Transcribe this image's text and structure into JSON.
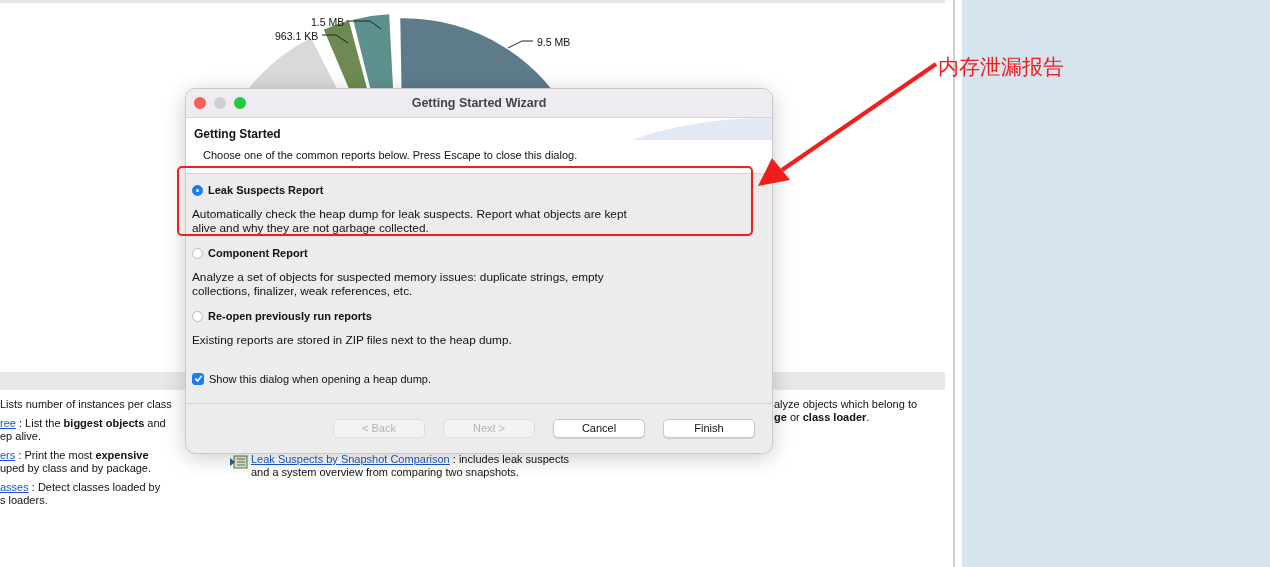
{
  "chart": {
    "labels": [
      {
        "text": "1.5 MB"
      },
      {
        "text": "963.1 KB"
      },
      {
        "text": "9.5 MB"
      }
    ]
  },
  "sections": {
    "left": [
      {
        "lines": [
          "Lists number of instances per class"
        ]
      },
      {
        "link": "ree",
        "lines": [
          " : List the  **biggest objects**  and",
          "ep alive."
        ]
      },
      {
        "link": "ers",
        "lines": [
          " : Print the most  **expensive**",
          "uped by class and by package."
        ]
      },
      {
        "link": "asses",
        "lines": [
          " : Detect classes loaded by",
          "s loaders."
        ]
      }
    ],
    "middle": [
      {
        "link": "Leak Suspects by Snapshot Comparison",
        "lines": [
          " : includes leak suspects",
          "and a system overview from comparing two snapshots."
        ]
      }
    ],
    "right": [
      {
        "lines": [
          "alyze objects which belong to",
          "**ge** or **class loader**."
        ]
      }
    ]
  },
  "dialog": {
    "title": "Getting Started Wizard",
    "heading": "Getting Started",
    "subtitle": "Choose one of the common reports below. Press Escape to close this dialog.",
    "options": [
      {
        "label": "Leak Suspects Report",
        "description": "Automatically check the heap dump for leak suspects. Report what objects are kept alive and why they are not garbage collected.",
        "selected": true
      },
      {
        "label": "Component Report",
        "description": "Analyze a set of objects for suspected memory issues: duplicate strings, empty collections, finalizer, weak references, etc.",
        "selected": false
      },
      {
        "label": "Re-open previously run reports",
        "description": "Existing reports are stored in ZIP files next to the heap dump.",
        "selected": false
      }
    ],
    "checkbox": {
      "label": "Show this dialog when opening a heap dump.",
      "checked": true
    },
    "buttons": [
      {
        "label": "< Back",
        "disabled": true
      },
      {
        "label": "Next >",
        "disabled": true
      },
      {
        "label": "Cancel",
        "disabled": false
      },
      {
        "label": "Finish",
        "disabled": false
      }
    ]
  },
  "annotation": {
    "text": "内存泄漏报告"
  }
}
